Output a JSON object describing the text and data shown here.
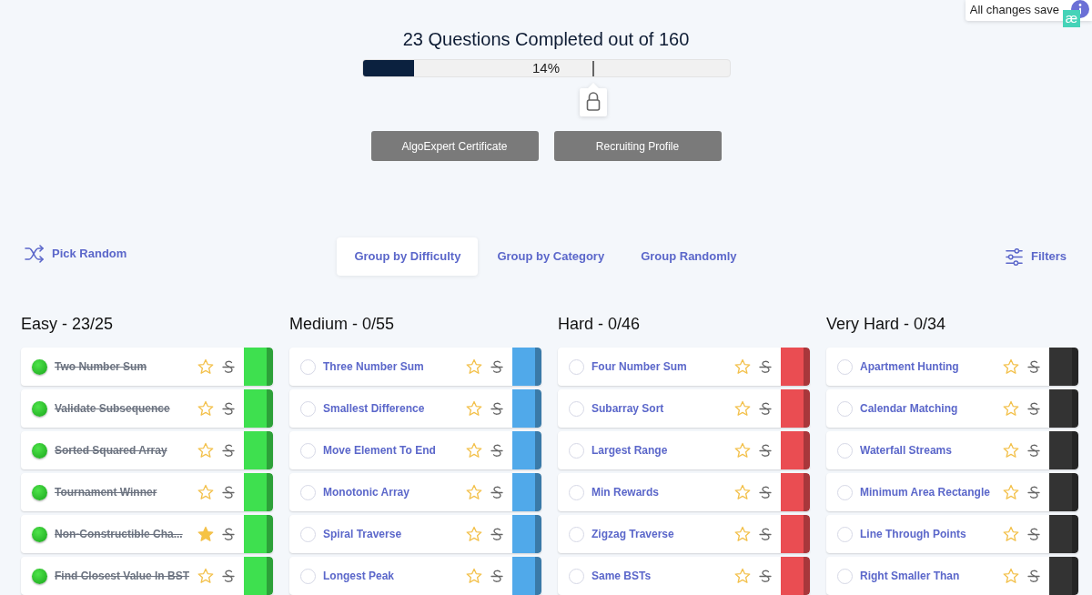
{
  "toast": {
    "text": "All changes save",
    "logo": "æ"
  },
  "progress": {
    "title": "23 Questions Completed out of 160",
    "level": 0.14,
    "label": "14%",
    "locked": true
  },
  "buttons": [
    {
      "label": "AlgoExpert Certificate",
      "disabled": true
    },
    {
      "label": "Recruiting Profile",
      "disabled": true
    }
  ],
  "toolbar": {
    "pick_random": "Pick Random",
    "tabs": [
      {
        "label": "Group by Difficulty",
        "selected": true
      },
      {
        "label": "Group by Category",
        "selected": false
      },
      {
        "label": "Group Randomly",
        "selected": false
      }
    ],
    "filters": "Filters"
  },
  "groups": [
    {
      "title": "Easy - 23/25",
      "color": "#3ee04f",
      "questions": [
        {
          "name": "Two Number Sum",
          "completed": true,
          "starred": false
        },
        {
          "name": "Validate Subsequence",
          "completed": true,
          "starred": false
        },
        {
          "name": "Sorted Squared Array",
          "completed": true,
          "starred": false
        },
        {
          "name": "Tournament Winner",
          "completed": true,
          "starred": false
        },
        {
          "name": "Non-Constructible Cha...",
          "completed": true,
          "starred": true
        },
        {
          "name": "Find Closest Value In BST",
          "completed": true,
          "starred": false
        }
      ]
    },
    {
      "title": "Medium - 0/55",
      "color": "#50a9ea",
      "questions": [
        {
          "name": "Three Number Sum",
          "completed": false,
          "starred": false
        },
        {
          "name": "Smallest Difference",
          "completed": false,
          "starred": false
        },
        {
          "name": "Move Element To End",
          "completed": false,
          "starred": false
        },
        {
          "name": "Monotonic Array",
          "completed": false,
          "starred": false
        },
        {
          "name": "Spiral Traverse",
          "completed": false,
          "starred": false
        },
        {
          "name": "Longest Peak",
          "completed": false,
          "starred": false
        }
      ]
    },
    {
      "title": "Hard - 0/46",
      "color": "#ea4d52",
      "questions": [
        {
          "name": "Four Number Sum",
          "completed": false,
          "starred": false
        },
        {
          "name": "Subarray Sort",
          "completed": false,
          "starred": false
        },
        {
          "name": "Largest Range",
          "completed": false,
          "starred": false
        },
        {
          "name": "Min Rewards",
          "completed": false,
          "starred": false
        },
        {
          "name": "Zigzag Traverse",
          "completed": false,
          "starred": false
        },
        {
          "name": "Same BSTs",
          "completed": false,
          "starred": false
        }
      ]
    },
    {
      "title": "Very Hard - 0/34",
      "color": "#333333",
      "questions": [
        {
          "name": "Apartment Hunting",
          "completed": false,
          "starred": false
        },
        {
          "name": "Calendar Matching",
          "completed": false,
          "starred": false
        },
        {
          "name": "Waterfall Streams",
          "completed": false,
          "starred": false
        },
        {
          "name": "Minimum Area Rectangle",
          "completed": false,
          "starred": false
        },
        {
          "name": "Line Through Points",
          "completed": false,
          "starred": false
        },
        {
          "name": "Right Smaller Than",
          "completed": false,
          "starred": false
        }
      ]
    }
  ]
}
